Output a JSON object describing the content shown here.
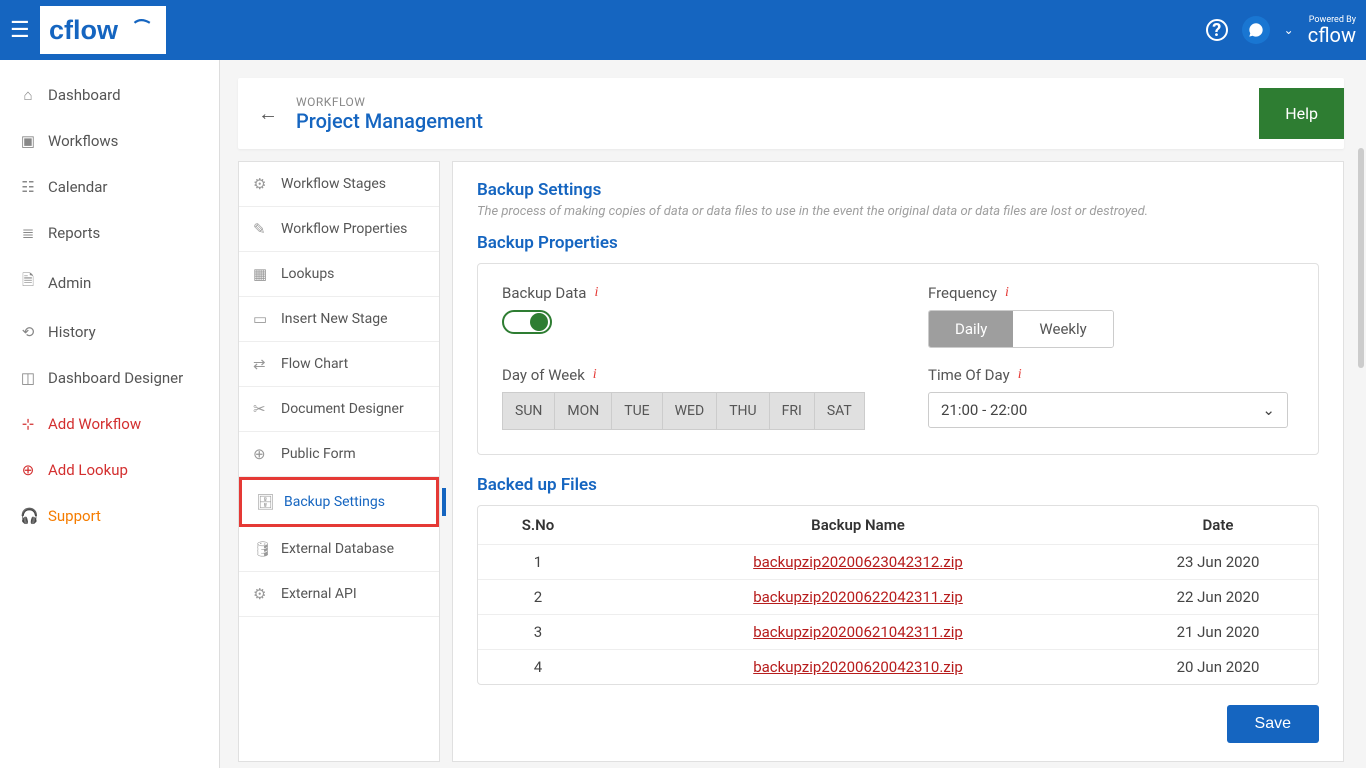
{
  "header": {
    "powered_by": "Powered By",
    "brand": "cflow"
  },
  "nav": [
    {
      "label": "Dashboard",
      "icon": "⌂",
      "cls": ""
    },
    {
      "label": "Workflows",
      "icon": "▣",
      "cls": ""
    },
    {
      "label": "Calendar",
      "icon": "☷",
      "cls": ""
    },
    {
      "label": "Reports",
      "icon": "≣",
      "cls": ""
    },
    {
      "label": "Admin",
      "icon": "🗎",
      "cls": ""
    },
    {
      "label": "History",
      "icon": "⟲",
      "cls": ""
    },
    {
      "label": "Dashboard Designer",
      "icon": "◫",
      "cls": ""
    },
    {
      "label": "Add Workflow",
      "icon": "⊹",
      "cls": "red"
    },
    {
      "label": "Add Lookup",
      "icon": "⊕",
      "cls": "red"
    },
    {
      "label": "Support",
      "icon": "🎧",
      "cls": "orange"
    }
  ],
  "page": {
    "breadcrumb": "WORKFLOW",
    "title": "Project Management",
    "help": "Help"
  },
  "sub": [
    {
      "label": "Workflow Stages",
      "icon": "⚙"
    },
    {
      "label": "Workflow Properties",
      "icon": "✎"
    },
    {
      "label": "Lookups",
      "icon": "▦"
    },
    {
      "label": "Insert New Stage",
      "icon": "▭"
    },
    {
      "label": "Flow Chart",
      "icon": "⇄"
    },
    {
      "label": "Document Designer",
      "icon": "✂"
    },
    {
      "label": "Public Form",
      "icon": "⊕"
    },
    {
      "label": "Backup Settings",
      "icon": "🗄",
      "active": true
    },
    {
      "label": "External Database",
      "icon": "🛢"
    },
    {
      "label": "External API",
      "icon": "⚙"
    }
  ],
  "settings": {
    "title": "Backup Settings",
    "desc": "The process of making copies of data or data files to use in the event the original data or data files are lost or destroyed.",
    "props_title": "Backup Properties",
    "backup_data_label": "Backup Data",
    "backup_data_on": true,
    "freq_label": "Frequency",
    "freq_options": [
      "Daily",
      "Weekly"
    ],
    "freq_selected": "Daily",
    "dow_label": "Day of Week",
    "days": [
      "SUN",
      "MON",
      "TUE",
      "WED",
      "THU",
      "FRI",
      "SAT"
    ],
    "tod_label": "Time Of Day",
    "tod_value": "21:00 - 22:00",
    "files_title": "Backed up Files",
    "columns": [
      "S.No",
      "Backup Name",
      "Date"
    ],
    "rows": [
      {
        "n": "1",
        "name": "backupzip20200623042312.zip",
        "date": "23 Jun 2020"
      },
      {
        "n": "2",
        "name": "backupzip20200622042311.zip",
        "date": "22 Jun 2020"
      },
      {
        "n": "3",
        "name": "backupzip20200621042311.zip",
        "date": "21 Jun 2020"
      },
      {
        "n": "4",
        "name": "backupzip20200620042310.zip",
        "date": "20 Jun 2020"
      }
    ],
    "save": "Save"
  }
}
